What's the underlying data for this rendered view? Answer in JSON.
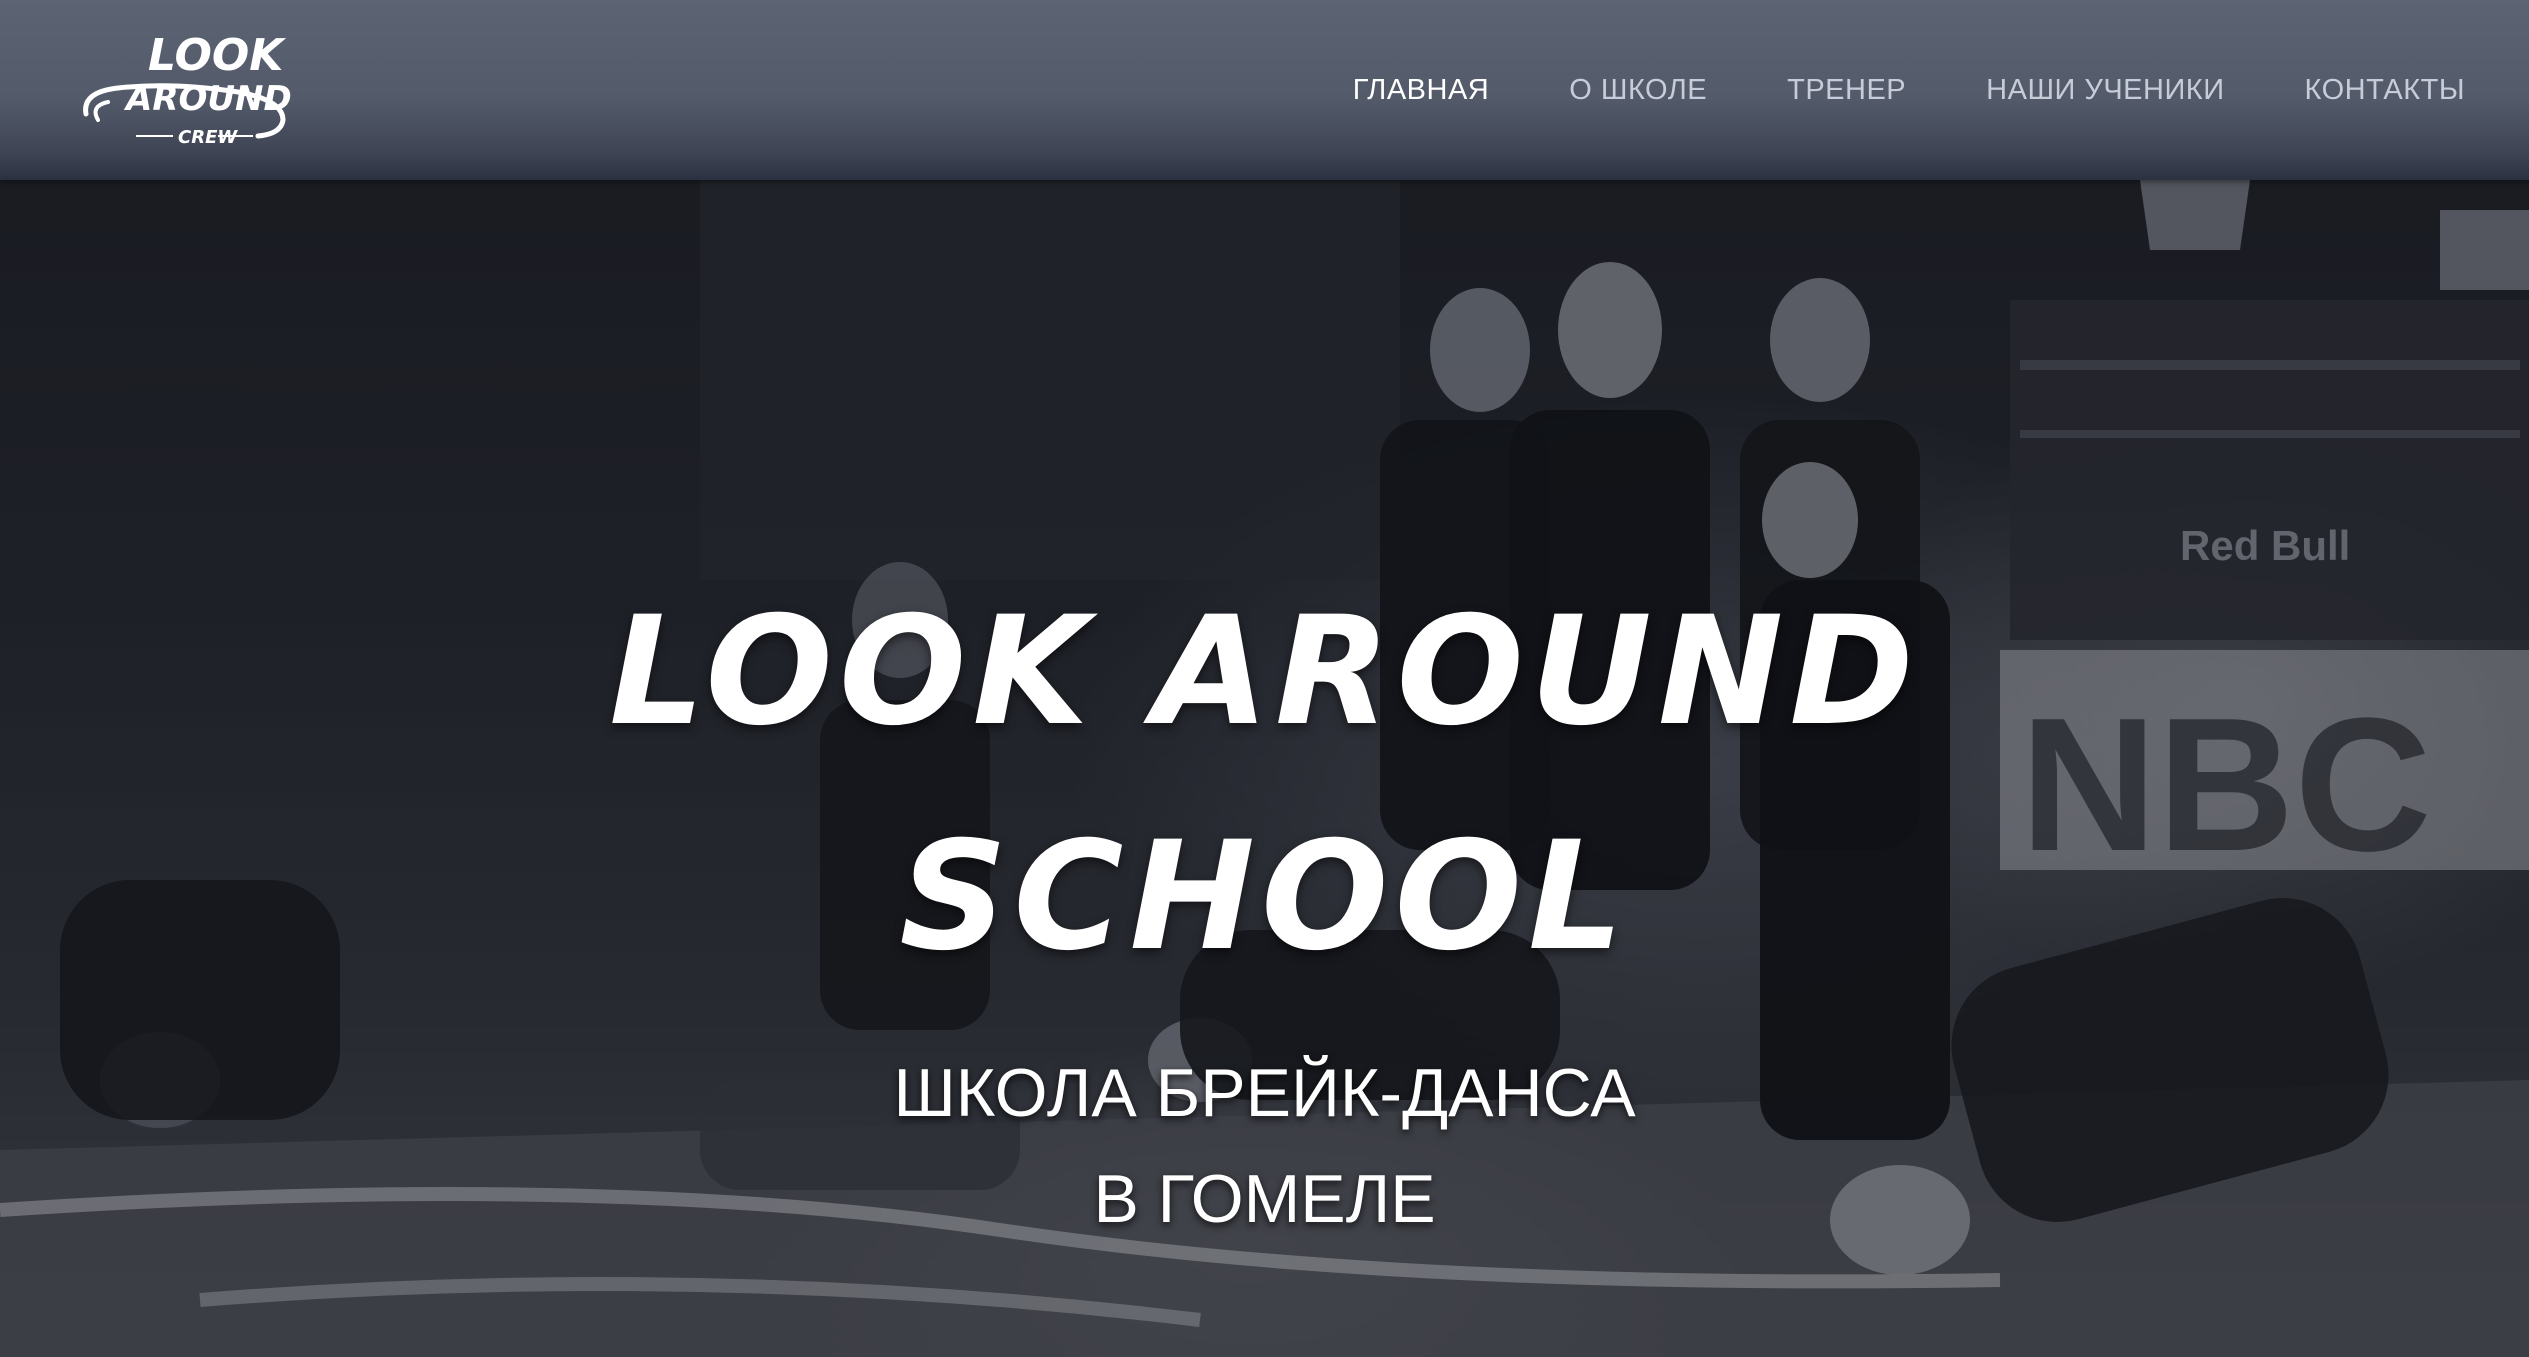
{
  "brand": {
    "logo_top": "LOOK",
    "logo_mid": "AROUND",
    "logo_sub": "CREW"
  },
  "nav": {
    "items": [
      {
        "label": "ГЛАВНАЯ",
        "active": true
      },
      {
        "label": "О ШКОЛЕ",
        "active": false
      },
      {
        "label": "ТРЕНЕР",
        "active": false
      },
      {
        "label": "НАШИ УЧЕНИКИ",
        "active": false
      },
      {
        "label": "КОНТАКТЫ",
        "active": false
      }
    ]
  },
  "hero": {
    "title_line1": "LOOK AROUND",
    "title_line2": "SCHOOL",
    "subtitle_line1": "ШКОЛА БРЕЙК-ДАНСА",
    "subtitle_line2": "В ГОМЕЛЕ",
    "background_signs": {
      "banner_right": "NBC",
      "sponsor": "Red Bull"
    }
  },
  "colors": {
    "navbar": "#535a6a",
    "nav_text": "#c7ccd8",
    "nav_active": "#ffffff",
    "hero_text": "#ffffff"
  },
  "icons": [
    "logo-icon"
  ]
}
